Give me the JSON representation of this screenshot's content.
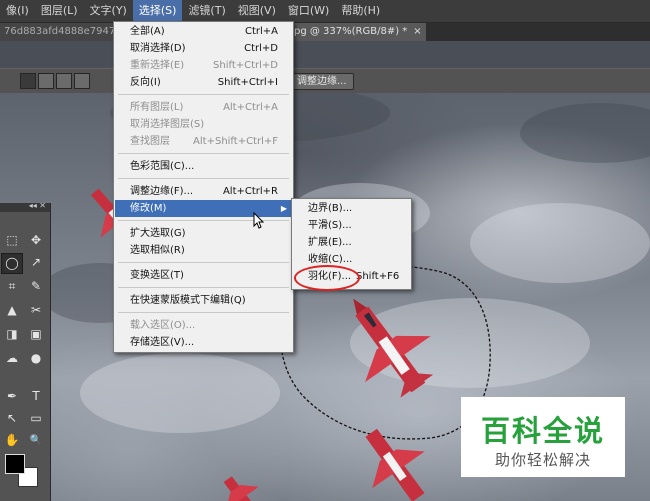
{
  "menubar": {
    "items": [
      "像(I)",
      "图层(L)",
      "文字(Y)",
      "选择(S)",
      "滤镜(T)",
      "视图(V)",
      "窗口(W)",
      "帮助(H)"
    ],
    "active": "选择(S)"
  },
  "tabs": {
    "tab1": "76d883afd4888e7947a3",
    "tab2": "pg @ 337%(RGB/8#) *",
    "close": "×"
  },
  "options": {
    "refine_edge": "调整边缘..."
  },
  "tools_header": "◂◂ ✕",
  "select_menu": {
    "items": [
      {
        "label": "全部(A)",
        "shortcut": "Ctrl+A",
        "disabled": false
      },
      {
        "label": "取消选择(D)",
        "shortcut": "Ctrl+D",
        "disabled": false
      },
      {
        "label": "重新选择(E)",
        "shortcut": "Shift+Ctrl+D",
        "disabled": true
      },
      {
        "label": "反向(I)",
        "shortcut": "Shift+Ctrl+I",
        "disabled": false
      },
      {
        "label": "所有图层(L)",
        "shortcut": "Alt+Ctrl+A",
        "disabled": true
      },
      {
        "label": "取消选择图层(S)",
        "shortcut": "",
        "disabled": true
      },
      {
        "label": "查找图层",
        "shortcut": "Alt+Shift+Ctrl+F",
        "disabled": true
      },
      {
        "label": "色彩范围(C)...",
        "shortcut": "",
        "disabled": false
      },
      {
        "label": "调整边缘(F)...",
        "shortcut": "Alt+Ctrl+R",
        "disabled": false
      },
      {
        "label": "修改(M)",
        "shortcut": "",
        "disabled": false,
        "highlighted": true,
        "submenu": true
      },
      {
        "label": "扩大选取(G)",
        "shortcut": "",
        "disabled": false
      },
      {
        "label": "选取相似(R)",
        "shortcut": "",
        "disabled": false
      },
      {
        "label": "变换选区(T)",
        "shortcut": "",
        "disabled": false
      },
      {
        "label": "在快速蒙版模式下编辑(Q)",
        "shortcut": "",
        "disabled": false
      },
      {
        "label": "载入选区(O)...",
        "shortcut": "",
        "disabled": true
      },
      {
        "label": "存储选区(V)...",
        "shortcut": "",
        "disabled": false
      }
    ]
  },
  "modify_submenu": {
    "items": [
      {
        "label": "边界(B)...",
        "shortcut": ""
      },
      {
        "label": "平滑(S)...",
        "shortcut": ""
      },
      {
        "label": "扩展(E)...",
        "shortcut": ""
      },
      {
        "label": "收缩(C)...",
        "shortcut": ""
      },
      {
        "label": "羽化(F)...",
        "shortcut": "Shift+F6"
      }
    ]
  },
  "tools_panel": {
    "glyphs": [
      "⬚",
      "✥",
      "◯",
      "↗",
      "⌗",
      "✎",
      "▲",
      "✂",
      "◨",
      "▣",
      "☁",
      "●",
      "✒",
      "T",
      "↖",
      "▭",
      "✋",
      "🔍"
    ]
  },
  "watermark": {
    "title": "百科全说",
    "subtitle": "助你轻松解决",
    "color": "#27a13c"
  }
}
